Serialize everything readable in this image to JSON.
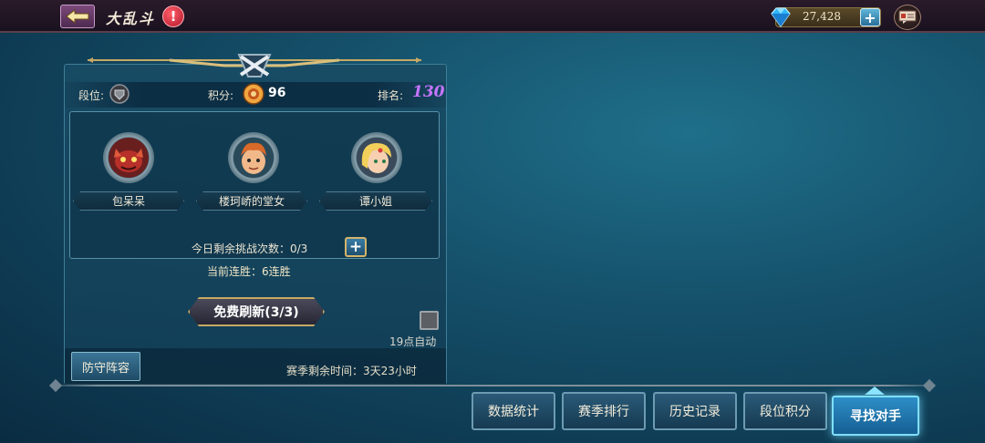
{
  "header": {
    "title": "大乱斗",
    "help_glyph": "!",
    "diamonds": "27,428",
    "add_glyph": "+"
  },
  "stats": {
    "rank_label": "段位:",
    "score_label": "积分:",
    "score_value": "96",
    "place_label": "排名:",
    "place_value": "130"
  },
  "opponents": [
    {
      "name": "包呆呆",
      "avatar": "red-dragon-avatar"
    },
    {
      "name": "楼珂峤的堂女",
      "avatar": "orange-hair-boy-avatar"
    },
    {
      "name": "谭小姐",
      "avatar": "blonde-girl-avatar"
    }
  ],
  "challenges": {
    "text": "今日剩余挑战次数：0/3",
    "add_glyph": "+"
  },
  "streak_text": "当前连胜：6连胜",
  "refresh_label": "免费刷新(3/3)",
  "auto_label": "19点自动",
  "defense_label": "防守阵容",
  "season_text": "赛季剩余时间：3天23小时",
  "tabs": [
    "数据统计",
    "赛季排行",
    "历史记录",
    "段位积分"
  ],
  "find_label": "寻找对手",
  "colors": {
    "accent_gold": "#c7a965",
    "place_purple": "#c575ff",
    "find_button": "#2e8ec7"
  }
}
